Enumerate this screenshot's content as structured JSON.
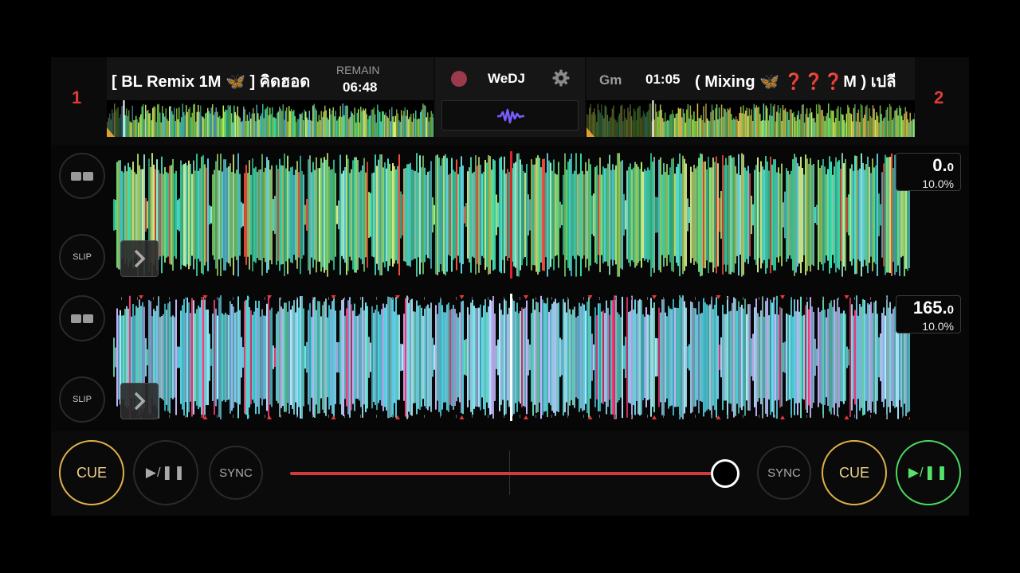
{
  "app": {
    "brand": "WeDJ"
  },
  "colors": {
    "accent_red": "#e23a3a",
    "cue_gold": "#e0b14a",
    "play_green": "#4bd860",
    "wave_button_purple": "#7a5cff"
  },
  "deck1": {
    "number": "1",
    "title": "[ BL Remix 1M 🦋 ] คิดฮอด",
    "remain_label": "REMAIN",
    "remain_time": "06:48",
    "bpm_whole": "0.",
    "bpm_frac": "0",
    "pitch": "10.0%",
    "slip_label": "SLIP",
    "cue_label": "CUE",
    "play_label": "▶/❚❚",
    "sync_label": "SYNC",
    "overview_progress": 0.05
  },
  "deck2": {
    "number": "2",
    "title": "( Mixing 🦋 ❓❓❓M ) เปลี",
    "key": "Gm",
    "time": "01:05",
    "bpm_whole": "165.",
    "bpm_frac": "0",
    "pitch": "10.0%",
    "slip_label": "SLIP",
    "cue_label": "CUE",
    "play_label": "▶/❚❚",
    "sync_label": "SYNC",
    "overview_progress": 0.2
  },
  "mixer": {
    "crossfader_position": 0.99
  },
  "icons": {
    "record": "record-icon",
    "settings": "gear-icon",
    "waveform": "waveform-icon",
    "loop": "loop-icon",
    "expand": "chevron-right-icon"
  }
}
